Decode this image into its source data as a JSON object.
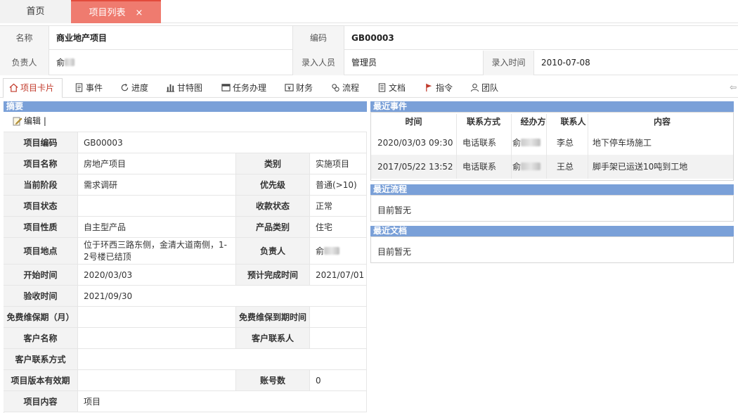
{
  "tabs": [
    {
      "label": "首页"
    },
    {
      "label": "项目列表",
      "close": "×"
    }
  ],
  "header": {
    "name_label": "名称",
    "name_value": "商业地产项目",
    "code_label": "编码",
    "code_value": "GB00003",
    "owner_label": "负责人",
    "owner_value": "俞",
    "entry_person_label": "录入人员",
    "entry_person_value": "管理员",
    "entry_time_label": "录入时间",
    "entry_time_value": "2010-07-08"
  },
  "subtabs": [
    "项目卡片",
    "事件",
    "进度",
    "甘特图",
    "任务办理",
    "财务",
    "流程",
    "文档",
    "指令",
    "团队"
  ],
  "summary": {
    "title": "摘要",
    "edit_label": "编辑 |",
    "rows": {
      "code": {
        "label": "项目编码",
        "value": "GB00003"
      },
      "name": {
        "label": "项目名称",
        "value": "房地产项目"
      },
      "category": {
        "label": "类别",
        "value": "实施项目"
      },
      "stage": {
        "label": "当前阶段",
        "value": "需求调研"
      },
      "priority": {
        "label": "优先级",
        "value": "普通(>10)"
      },
      "status": {
        "label": "项目状态",
        "value": ""
      },
      "payment_status": {
        "label": "收款状态",
        "value": "正常"
      },
      "nature": {
        "label": "项目性质",
        "value": "自主型产品"
      },
      "product_type": {
        "label": "产品类别",
        "value": "住宅"
      },
      "location": {
        "label": "项目地点",
        "value": "位于环西三路东侧，金清大道南侧，1-2号楼已结顶"
      },
      "owner": {
        "label": "负责人",
        "value": "俞"
      },
      "start": {
        "label": "开始时间",
        "value": "2020/03/03"
      },
      "planned_finish": {
        "label": "预计完成时间",
        "value": "2021/07/01"
      },
      "acceptance": {
        "label": "验收时间",
        "value": "2021/09/30"
      },
      "warranty_months": {
        "label": "免费维保期（月）",
        "value": ""
      },
      "warranty_expiry": {
        "label": "免费维保到期时间",
        "value": ""
      },
      "client_name": {
        "label": "客户名称",
        "value": ""
      },
      "client_contact": {
        "label": "客户联系人",
        "value": ""
      },
      "client_contact_info": {
        "label": "客户联系方式",
        "value": ""
      },
      "version_validity": {
        "label": "项目版本有效期",
        "value": ""
      },
      "account_count": {
        "label": "账号数",
        "value": "0"
      },
      "content": {
        "label": "项目内容",
        "value": "项目"
      }
    }
  },
  "events": {
    "title": "最近事件",
    "columns": [
      "时间",
      "联系方式",
      "经办方",
      "联系人",
      "内容"
    ],
    "rows": [
      {
        "time": "2020/03/03 09:30",
        "method": "电话联系",
        "handler": "俞",
        "contact": "李总",
        "content": "地下停车场施工"
      },
      {
        "time": "2017/05/22 13:52",
        "method": "电话联系",
        "handler": "俞",
        "contact": "王总",
        "content": "脚手架已运送10吨到工地"
      }
    ]
  },
  "flows": {
    "title": "最近流程",
    "empty": "目前暂无"
  },
  "docs": {
    "title": "最近文档",
    "empty": "目前暂无"
  },
  "colors": {
    "accent": "#ef7b6f",
    "panel_header": "#7aa0d8",
    "active_text": "#c23a2b"
  }
}
